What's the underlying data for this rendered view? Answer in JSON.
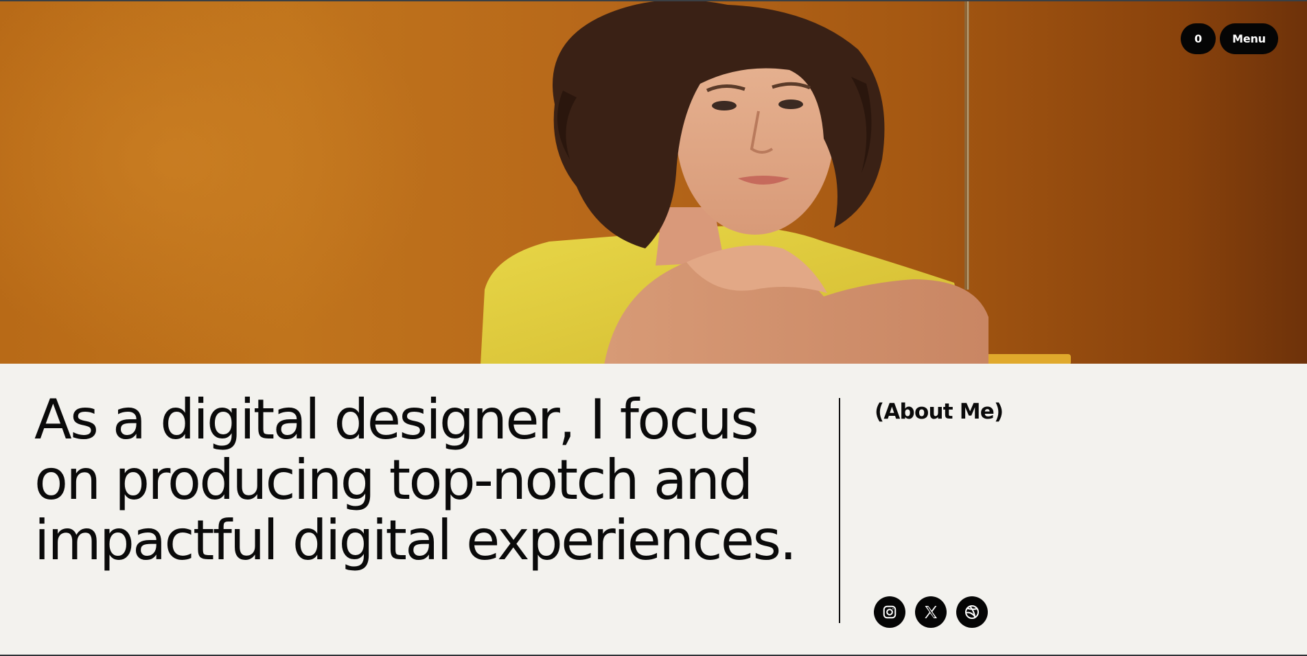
{
  "header": {
    "cart_count": "0",
    "menu_label": "Menu"
  },
  "hero": {
    "icon": "portrait-photo",
    "background_color": "#b86a17",
    "shirt_color": "#e4cf3e"
  },
  "intro": {
    "headline": "As a digital designer, I focus on producing top-notch and impactful digital experiences.",
    "section_label": "(About Me)"
  },
  "socials": [
    {
      "icon": "instagram-icon"
    },
    {
      "icon": "x-icon"
    },
    {
      "icon": "dribbble-icon"
    }
  ]
}
